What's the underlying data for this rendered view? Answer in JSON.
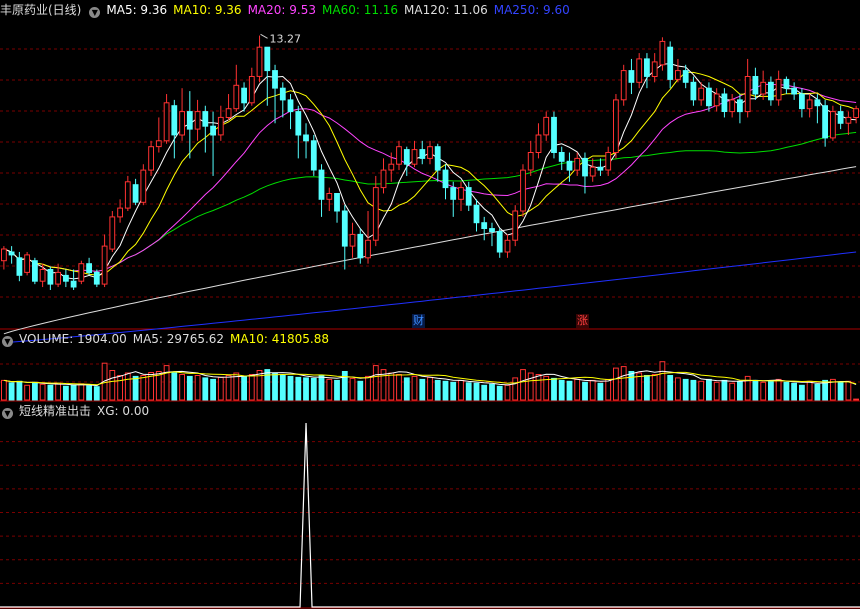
{
  "header": {
    "stock_name": "丰原药业(日线)",
    "ma_labels": [
      {
        "text": "MA5: 9.36",
        "color": "#ffffff"
      },
      {
        "text": "MA10: 9.36",
        "color": "#ffff00"
      },
      {
        "text": "MA20: 9.53",
        "color": "#ff44ff"
      },
      {
        "text": "MA60: 11.16",
        "color": "#00dd00"
      },
      {
        "text": "MA120: 11.06",
        "color": "#dddddd"
      },
      {
        "text": "MA250: 9.60",
        "color": "#3344ff"
      }
    ]
  },
  "volume_header": {
    "title": "VOLUME: 1904.00",
    "ma5": "MA5: 29765.62",
    "ma10": "MA10: 41805.88"
  },
  "indicator_header": {
    "title": "短线精准出击",
    "xg": "XG: 0.00"
  },
  "markers": {
    "cai": "财",
    "zhang": "涨"
  },
  "colors": {
    "up": "#ff3232",
    "down": "#54ffff",
    "ma5": "#ffffff",
    "ma10": "#ffff00",
    "ma20": "#ff44ff",
    "ma60": "#00dd00",
    "ma120": "#dddddd",
    "ma250": "#2030ff",
    "grid": "#7a0000",
    "divider": "#aa0000"
  },
  "chart_data": {
    "type": "candlestick",
    "price_range": [
      8.3,
      13.6
    ],
    "annotation": {
      "text": "13.27",
      "value": 13.27
    },
    "candles": [
      [
        9.45,
        9.65,
        9.7,
        9.3
      ],
      [
        9.6,
        9.55,
        9.7,
        9.4
      ],
      [
        9.5,
        9.2,
        9.6,
        9.1
      ],
      [
        9.25,
        9.55,
        9.6,
        9.2
      ],
      [
        9.45,
        9.1,
        9.5,
        9.05
      ],
      [
        9.1,
        9.3,
        9.4,
        9.0
      ],
      [
        9.3,
        9.05,
        9.35,
        8.95
      ],
      [
        9.05,
        9.25,
        9.4,
        9.0
      ],
      [
        9.2,
        9.1,
        9.3,
        9.0
      ],
      [
        9.1,
        9.0,
        9.3,
        8.95
      ],
      [
        9.1,
        9.4,
        9.45,
        9.05
      ],
      [
        9.4,
        9.25,
        9.5,
        9.2
      ],
      [
        9.25,
        9.05,
        9.3,
        9.0
      ],
      [
        9.05,
        9.7,
        9.9,
        9.0
      ],
      [
        9.65,
        10.2,
        10.3,
        9.6
      ],
      [
        10.2,
        10.35,
        10.5,
        10.1
      ],
      [
        10.35,
        10.8,
        10.9,
        10.3
      ],
      [
        10.75,
        10.45,
        10.85,
        10.4
      ],
      [
        10.45,
        11.0,
        11.1,
        10.4
      ],
      [
        11.0,
        11.4,
        11.5,
        10.9
      ],
      [
        11.4,
        11.5,
        11.9,
        11.3
      ],
      [
        11.5,
        12.15,
        12.3,
        11.45
      ],
      [
        12.1,
        11.6,
        12.2,
        11.2
      ],
      [
        11.6,
        12.0,
        12.4,
        11.5
      ],
      [
        12.0,
        11.7,
        12.35,
        11.2
      ],
      [
        11.7,
        12.0,
        12.2,
        11.5
      ],
      [
        12.0,
        11.75,
        12.1,
        11.3
      ],
      [
        11.75,
        11.6,
        12.0,
        10.9
      ],
      [
        11.6,
        11.9,
        12.1,
        11.5
      ],
      [
        11.9,
        12.05,
        12.3,
        11.85
      ],
      [
        12.05,
        12.45,
        12.8,
        12.0
      ],
      [
        12.4,
        12.15,
        12.5,
        12.0
      ],
      [
        12.15,
        12.6,
        12.75,
        12.1
      ],
      [
        12.6,
        13.1,
        13.3,
        12.5
      ],
      [
        13.1,
        12.7,
        13.1,
        12.1
      ],
      [
        12.7,
        12.4,
        12.8,
        11.8
      ],
      [
        12.4,
        12.2,
        12.5,
        11.9
      ],
      [
        12.2,
        12.0,
        12.3,
        11.7
      ],
      [
        12.0,
        11.6,
        12.1,
        11.2
      ],
      [
        11.6,
        11.5,
        11.8,
        11.2
      ],
      [
        11.5,
        11.0,
        11.6,
        10.9
      ],
      [
        11.0,
        10.5,
        11.1,
        10.2
      ],
      [
        10.5,
        10.6,
        10.7,
        10.3
      ],
      [
        10.6,
        10.3,
        10.6,
        10.1
      ],
      [
        10.3,
        9.7,
        10.4,
        9.3
      ],
      [
        9.7,
        9.9,
        10.1,
        9.5
      ],
      [
        9.9,
        9.5,
        10.0,
        9.4
      ],
      [
        9.5,
        9.8,
        10.3,
        9.4
      ],
      [
        9.8,
        10.7,
        10.9,
        9.7
      ],
      [
        10.7,
        11.0,
        11.2,
        10.6
      ],
      [
        11.0,
        11.1,
        11.3,
        10.8
      ],
      [
        11.1,
        11.4,
        11.5,
        11.0
      ],
      [
        11.35,
        11.1,
        11.4,
        10.9
      ],
      [
        11.1,
        11.35,
        11.5,
        11.05
      ],
      [
        11.35,
        11.2,
        11.5,
        11.1
      ],
      [
        11.2,
        11.4,
        11.5,
        11.1
      ],
      [
        11.4,
        11.0,
        11.45,
        10.8
      ],
      [
        11.0,
        10.7,
        11.1,
        10.5
      ],
      [
        10.7,
        10.5,
        10.8,
        10.2
      ],
      [
        10.5,
        10.7,
        10.8,
        10.3
      ],
      [
        10.7,
        10.4,
        10.8,
        10.3
      ],
      [
        10.4,
        10.1,
        10.5,
        9.95
      ],
      [
        10.1,
        10.0,
        10.2,
        9.8
      ],
      [
        10.0,
        9.95,
        10.1,
        9.7
      ],
      [
        9.95,
        9.6,
        10.0,
        9.5
      ],
      [
        9.6,
        9.8,
        9.9,
        9.5
      ],
      [
        9.8,
        10.3,
        10.4,
        9.7
      ],
      [
        10.3,
        11.0,
        11.1,
        10.2
      ],
      [
        11.0,
        11.3,
        11.5,
        10.9
      ],
      [
        11.3,
        11.6,
        11.8,
        11.2
      ],
      [
        11.6,
        11.9,
        12.0,
        11.5
      ],
      [
        11.9,
        11.3,
        12.0,
        11.2
      ],
      [
        11.3,
        11.15,
        11.4,
        11.0
      ],
      [
        11.15,
        11.0,
        11.3,
        10.8
      ],
      [
        11.0,
        11.2,
        11.3,
        10.9
      ],
      [
        11.2,
        10.9,
        11.3,
        10.6
      ],
      [
        10.9,
        11.05,
        11.2,
        10.8
      ],
      [
        11.05,
        11.0,
        11.2,
        10.9
      ],
      [
        11.0,
        11.3,
        11.4,
        10.9
      ],
      [
        11.3,
        12.2,
        12.3,
        11.2
      ],
      [
        12.2,
        12.7,
        12.8,
        12.1
      ],
      [
        12.7,
        12.5,
        12.9,
        12.3
      ],
      [
        12.5,
        12.9,
        13.0,
        12.4
      ],
      [
        12.9,
        12.6,
        13.0,
        12.4
      ],
      [
        12.6,
        12.85,
        13.0,
        12.5
      ],
      [
        12.8,
        13.2,
        13.27,
        12.7
      ],
      [
        13.1,
        12.55,
        13.2,
        12.4
      ],
      [
        12.55,
        12.7,
        12.9,
        12.5
      ],
      [
        12.7,
        12.5,
        12.8,
        12.4
      ],
      [
        12.5,
        12.2,
        12.6,
        12.1
      ],
      [
        12.2,
        12.4,
        12.5,
        12.1
      ],
      [
        12.4,
        12.1,
        12.5,
        12.0
      ],
      [
        12.1,
        12.3,
        12.4,
        12.0
      ],
      [
        12.3,
        12.0,
        12.4,
        11.9
      ],
      [
        12.0,
        12.2,
        12.3,
        11.9
      ],
      [
        12.2,
        12.0,
        12.3,
        11.8
      ],
      [
        12.0,
        12.6,
        12.9,
        11.9
      ],
      [
        12.6,
        12.3,
        12.75,
        12.2
      ],
      [
        12.3,
        12.5,
        12.7,
        12.2
      ],
      [
        12.5,
        12.2,
        12.6,
        12.1
      ],
      [
        12.2,
        12.55,
        12.7,
        12.1
      ],
      [
        12.55,
        12.4,
        12.6,
        12.3
      ],
      [
        12.4,
        12.3,
        12.5,
        12.2
      ],
      [
        12.3,
        12.05,
        12.4,
        11.9
      ],
      [
        12.05,
        12.2,
        12.3,
        11.9
      ],
      [
        12.2,
        12.1,
        12.3,
        11.8
      ],
      [
        12.1,
        11.55,
        12.2,
        11.4
      ],
      [
        11.55,
        12.0,
        12.1,
        11.5
      ],
      [
        12.0,
        11.8,
        12.1,
        11.7
      ],
      [
        11.8,
        11.9,
        12.0,
        11.6
      ],
      [
        11.9,
        12.05,
        12.1,
        11.8
      ]
    ],
    "ma120_end": 11.06,
    "ma250_end": 9.6,
    "volume": {
      "range_max": 110000,
      "values": [
        40000,
        35000,
        38000,
        30000,
        36000,
        32000,
        30000,
        34000,
        28000,
        30000,
        33000,
        29000,
        27000,
        75000,
        60000,
        50000,
        55000,
        48000,
        50000,
        56000,
        58000,
        70000,
        55000,
        52000,
        48000,
        50000,
        45000,
        42000,
        46000,
        50000,
        55000,
        48000,
        52000,
        60000,
        62000,
        55000,
        50000,
        48000,
        46000,
        45000,
        44000,
        50000,
        42000,
        40000,
        58000,
        44000,
        38000,
        48000,
        70000,
        62000,
        55000,
        52000,
        45000,
        48000,
        42000,
        46000,
        40000,
        38000,
        36000,
        40000,
        35000,
        34000,
        30000,
        32000,
        28000,
        30000,
        45000,
        62000,
        55000,
        52000,
        48000,
        44000,
        40000,
        38000,
        42000,
        36000,
        40000,
        34000,
        42000,
        65000,
        68000,
        58000,
        55000,
        50000,
        52000,
        78000,
        50000,
        45000,
        42000,
        40000,
        38000,
        42000,
        36000,
        40000,
        34000,
        38000,
        48000,
        40000,
        36000,
        38000,
        42000,
        36000,
        34000,
        30000,
        38000,
        32000,
        40000,
        42000,
        36000,
        38000,
        1904
      ]
    },
    "signal": {
      "peak_index": 39,
      "peak_value": 1,
      "baseline": 0
    }
  }
}
